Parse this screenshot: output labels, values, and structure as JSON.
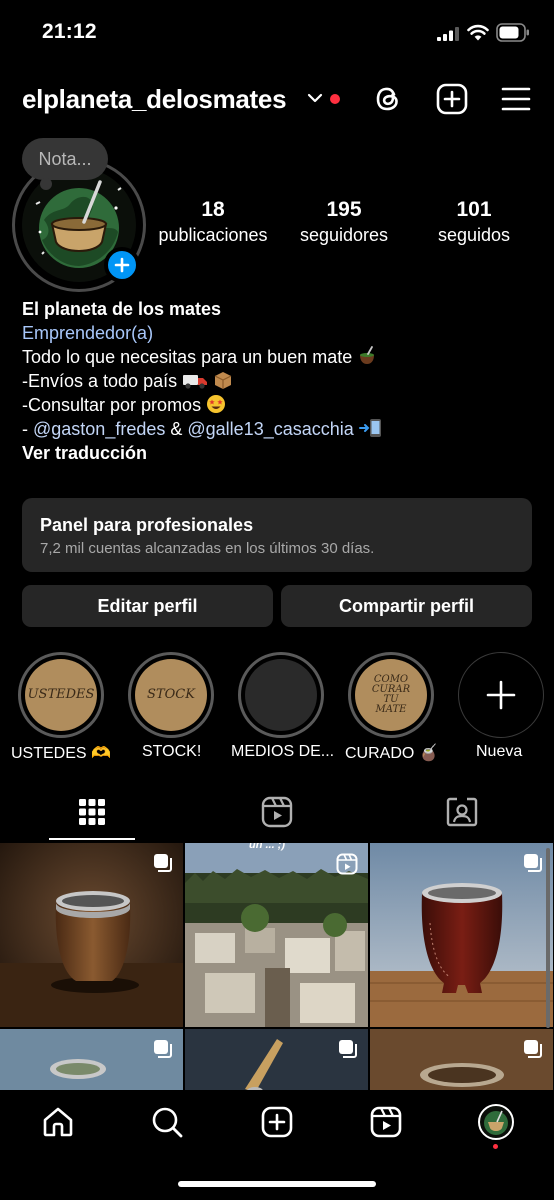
{
  "status_bar": {
    "time": "21:12"
  },
  "header": {
    "username": "elplaneta_delosmates"
  },
  "note": {
    "placeholder": "Nota..."
  },
  "stats": [
    {
      "value": "18",
      "label": "publicaciones"
    },
    {
      "value": "195",
      "label": "seguidores"
    },
    {
      "value": "101",
      "label": "seguidos"
    }
  ],
  "bio": {
    "name": "El planeta de los mates",
    "category": "Emprendedor(a)",
    "line1": "Todo lo que necesitas para un buen mate",
    "line2": "-Envíos a todo país",
    "line3": "-Consultar por promos",
    "line4_prefix": "- ",
    "mention1": "@gaston_fredes",
    "amp": " & ",
    "mention2": "@galle13_casacchia",
    "translate": "Ver traducción"
  },
  "pro_panel": {
    "title": "Panel para profesionales",
    "subtitle": "7,2 mil cuentas alcanzadas en los últimos 30 días."
  },
  "buttons": {
    "edit": "Editar perfil",
    "share": "Compartir perfil"
  },
  "highlights": [
    {
      "cover_text": "USTEDES",
      "label": "USTEDES 🫶"
    },
    {
      "cover_text": "STOCK",
      "label": "STOCK!"
    },
    {
      "cover_text": "",
      "label": "MEDIOS DE..."
    },
    {
      "cover_text": "COMO CURAR TU MATE",
      "label": "CURADO 🧉"
    },
    {
      "cover_text": "",
      "label": "Nueva"
    }
  ],
  "grid": {
    "overlay_text": "un ... ;)"
  },
  "colors": {
    "accent": "#0095f6",
    "link": "#a8c7fa",
    "surface": "#262626",
    "notification": "#ff3040"
  }
}
